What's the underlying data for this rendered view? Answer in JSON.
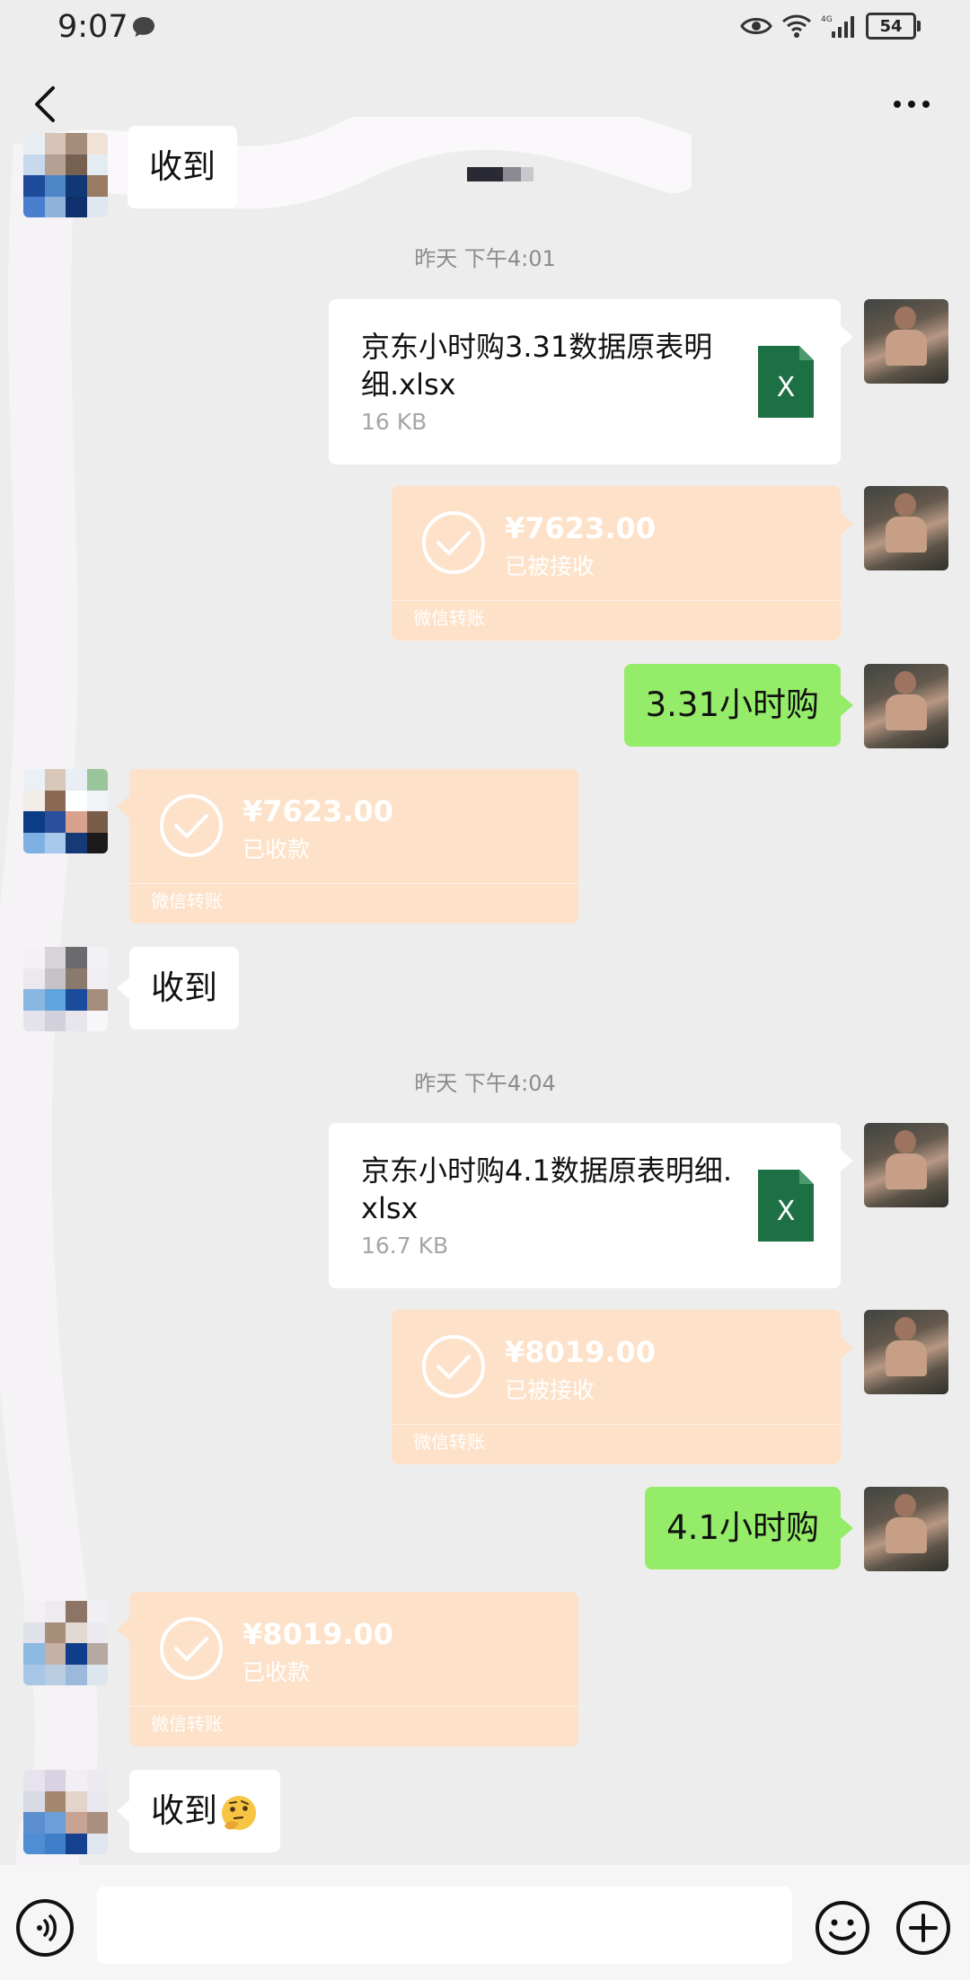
{
  "status_bar": {
    "time": "9:07",
    "battery": "54",
    "network": "4G"
  },
  "nav": {
    "back_icon": "chevron-left-icon",
    "more_icon": "more-dots-icon"
  },
  "messages": [
    {
      "type": "text",
      "side": "left",
      "text": "收到"
    },
    {
      "type": "timestamp",
      "text": "昨天 下午4:01"
    },
    {
      "type": "file",
      "side": "right",
      "name": "京东小时购3.31数据原表明细.xlsx",
      "size": "16 KB",
      "icon": "excel-file-icon"
    },
    {
      "type": "transfer",
      "side": "right",
      "amount": "¥7623.00",
      "status": "已被接收",
      "brand": "微信转账"
    },
    {
      "type": "text",
      "side": "right",
      "text": "3.31小时购"
    },
    {
      "type": "transfer",
      "side": "left",
      "amount": "¥7623.00",
      "status": "已收款",
      "brand": "微信转账"
    },
    {
      "type": "text",
      "side": "left",
      "text": "收到"
    },
    {
      "type": "timestamp",
      "text": "昨天 下午4:04"
    },
    {
      "type": "file",
      "side": "right",
      "name": "京东小时购4.1数据原表明细.xlsx",
      "size": "16.7 KB",
      "icon": "excel-file-icon"
    },
    {
      "type": "transfer",
      "side": "right",
      "amount": "¥8019.00",
      "status": "已被接收",
      "brand": "微信转账"
    },
    {
      "type": "text",
      "side": "right",
      "text": "4.1小时购"
    },
    {
      "type": "transfer",
      "side": "left",
      "amount": "¥8019.00",
      "status": "已收款",
      "brand": "微信转账"
    },
    {
      "type": "text",
      "side": "left",
      "text": "收到",
      "emoji": "thinking-face-emoji"
    }
  ],
  "input_bar": {
    "placeholder": "",
    "voice_icon": "voice-icon",
    "emoji_icon": "emoji-icon",
    "plus_icon": "plus-icon"
  },
  "colors": {
    "background": "#ededed",
    "self_bubble": "#95ec69",
    "transfer": "#fde1c8",
    "excel": "#1d7044"
  }
}
